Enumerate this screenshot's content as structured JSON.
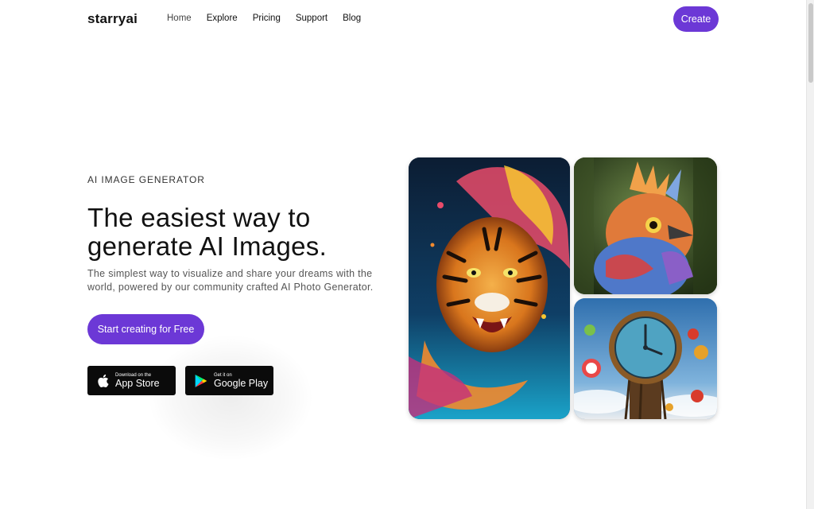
{
  "header": {
    "logo": "starryai",
    "nav": [
      {
        "label": "Home"
      },
      {
        "label": "Explore"
      },
      {
        "label": "Pricing"
      },
      {
        "label": "Support"
      },
      {
        "label": "Blog"
      }
    ],
    "create_label": "Create"
  },
  "hero": {
    "eyebrow": "AI IMAGE GENERATOR",
    "headline_line1": "The easiest way to",
    "headline_line2": "generate AI Images.",
    "subtext": "The simplest way to visualize and share your dreams with the world, powered by our community crafted AI Photo Generator.",
    "cta_label": "Start creating for Free"
  },
  "stores": {
    "apple": {
      "small": "Download on the",
      "big": "App Store",
      "icon": "apple-icon"
    },
    "google": {
      "small": "Get it on",
      "big": "Google Play",
      "icon": "google-play-icon"
    }
  },
  "gallery": [
    {
      "subject": "tiger"
    },
    {
      "subject": "bird"
    },
    {
      "subject": "clock"
    }
  ],
  "colors": {
    "accent": "#6c38d6",
    "store_bg": "#0b0b0b"
  }
}
